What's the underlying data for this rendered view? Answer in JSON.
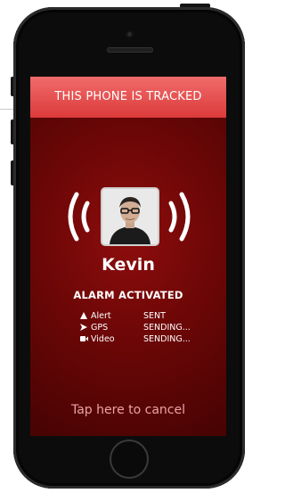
{
  "banner": {
    "text": "THIS PHONE IS TRACKED"
  },
  "contact": {
    "name": "Kevin"
  },
  "alarm": {
    "title": "ALARM ACTIVATED"
  },
  "status": [
    {
      "icon": "warning-icon",
      "label": "Alert",
      "value": "SENT"
    },
    {
      "icon": "location-arrow-icon",
      "label": "GPS",
      "value": "SENDING..."
    },
    {
      "icon": "video-camera-icon",
      "label": "Video",
      "value": "SENDING..."
    }
  ],
  "cancel": {
    "label": "Tap here to cancel"
  },
  "colors": {
    "banner": "#e84c4c",
    "screen_background": "#6e0707",
    "cancel_text": "#eaa3a3"
  }
}
